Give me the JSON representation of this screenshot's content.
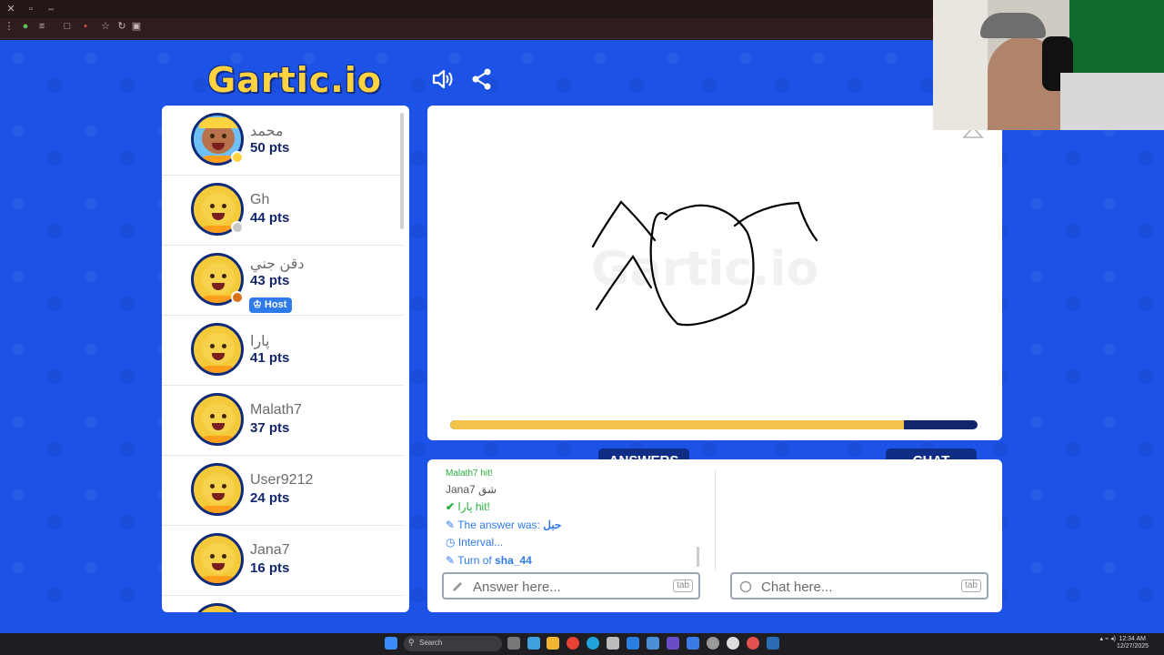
{
  "app": {
    "logo_text": "Gartic.io"
  },
  "players": [
    {
      "name": "محمد",
      "pts": "50 pts",
      "status_color": "#ffd23f"
    },
    {
      "name": "Gh",
      "pts": "44 pts",
      "status_color": "#c8c8c8"
    },
    {
      "name": "دقن جني",
      "pts": "43 pts",
      "status_color": "#d9731a",
      "host_label": "Host"
    },
    {
      "name": "پارا",
      "pts": "41 pts"
    },
    {
      "name": "Malath7",
      "pts": "37 pts"
    },
    {
      "name": "User9212",
      "pts": "24 pts"
    },
    {
      "name": "Jana7",
      "pts": "16 pts"
    }
  ],
  "timer": {
    "remaining_fraction": 0.86,
    "fill_color": "#f2c24a",
    "track_color": "#14266b"
  },
  "tabs": {
    "answers": "ANSWERS",
    "chat": "CHAT"
  },
  "answers_feed": {
    "cut_line": "Malath7 hit!",
    "line1_user": "Jana7",
    "line1_guess": "شق",
    "line2_name": "پارا",
    "line2_text": "hit!",
    "line3_text": "The answer was:",
    "line3_word": "حبل",
    "line4_text": "Interval...",
    "line5_text": "Turn of",
    "line5_user": "sha_44"
  },
  "answer_input": {
    "placeholder": "Answer here...",
    "key_hint": "tab"
  },
  "chat_input": {
    "placeholder": "Chat here...",
    "key_hint": "tab"
  },
  "taskbar": {
    "search_placeholder": "Search",
    "time": "12:34 AM",
    "date": "12/27/2025"
  },
  "colors": {
    "background": "#1c52e6",
    "navy": "#0f2c86",
    "accent_blue": "#2f7bea",
    "hit_green": "#27ae3c"
  }
}
